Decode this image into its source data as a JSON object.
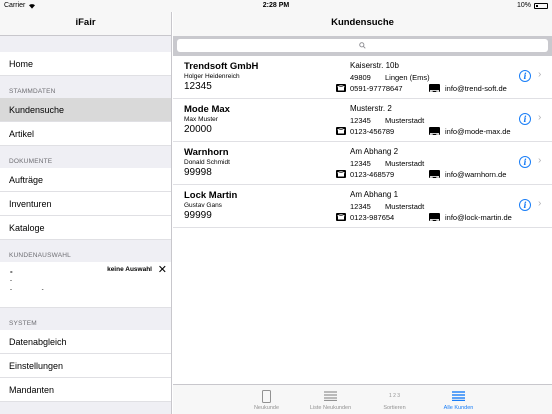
{
  "statusbar": {
    "carrier": "Carrier",
    "time": "2:28 PM",
    "battery": "10%"
  },
  "master": {
    "title": "iFair",
    "home": "Home",
    "sections": {
      "stammdaten": "STAMMDATEN",
      "dokumente": "DOKUMENTE",
      "kundenauswahl": "KUNDENAUSWAHL",
      "system": "SYSTEM"
    },
    "stammdaten_items": [
      "Kundensuche",
      "Artikel"
    ],
    "dokumente_items": [
      "Aufträge",
      "Inventuren",
      "Kataloge"
    ],
    "kundenauswahl": {
      "dash1": "-",
      "label": "keine Auswahl",
      "dash2": "-",
      "dash3": "- -"
    },
    "system_items": [
      "Datenabgleich",
      "Einstellungen",
      "Mandanten"
    ]
  },
  "detail": {
    "title": "Kundensuche",
    "customers": [
      {
        "name": "Trendsoft GmbH",
        "contact": "Holger Heidenreich",
        "nr": "12345",
        "street": "Kaiserstr. 10b",
        "zip": "49809",
        "city": "Lingen (Ems)",
        "phone": "0591-97778647",
        "mail": "info@trend-soft.de"
      },
      {
        "name": "Mode Max",
        "contact": "Max Muster",
        "nr": "20000",
        "street": "Musterstr. 2",
        "zip": "12345",
        "city": "Musterstadt",
        "phone": "0123-456789",
        "mail": "info@mode-max.de"
      },
      {
        "name": "Warnhorn",
        "contact": "Donald Schmidt",
        "nr": "99998",
        "street": "Am Abhang 2",
        "zip": "12345",
        "city": "Musterstadt",
        "phone": "0123-468579",
        "mail": "info@warnhorn.de"
      },
      {
        "name": "Lock Martin",
        "contact": "Gustav Gans",
        "nr": "99999",
        "street": "Am Abhang 1",
        "zip": "12345",
        "city": "Musterstadt",
        "phone": "0123-987654",
        "mail": "info@lock-martin.de"
      }
    ]
  },
  "tabbar": {
    "tabs": [
      {
        "label": "Neukunde",
        "icon": "document-icon"
      },
      {
        "label": "Liste Neukunden",
        "icon": "list-icon"
      },
      {
        "label": "Sortieren",
        "icon": "sort-icon",
        "glyph": "1 2 3"
      },
      {
        "label": "Alle Kunden",
        "icon": "list-icon"
      }
    ],
    "active": "Alle Kunden"
  },
  "colors": {
    "accent": "#1a7ef7",
    "selected_row": "#d9d9d9",
    "group_bg": "#efeff4"
  }
}
